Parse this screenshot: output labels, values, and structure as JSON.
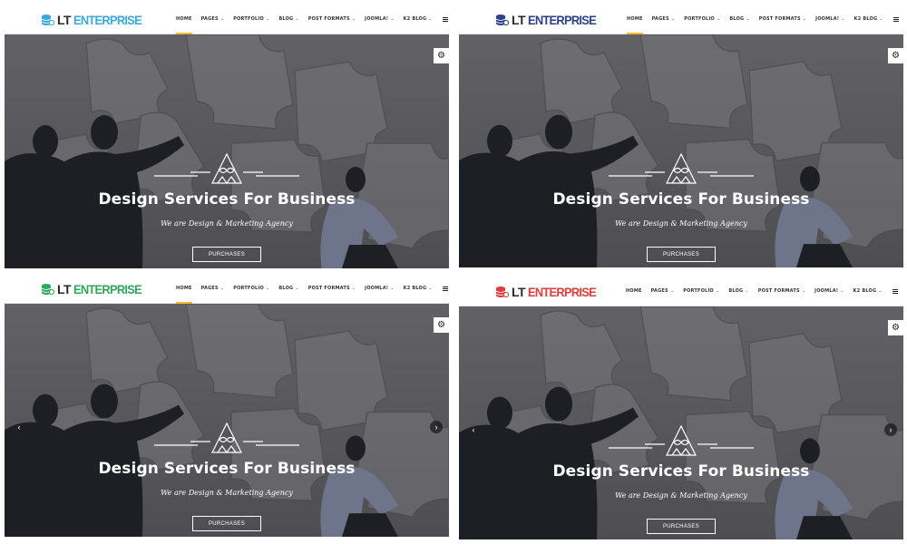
{
  "panels": [
    {
      "logo": {
        "lt": "LT",
        "enterprise": "ENTERPRISE",
        "accent_color": "#39a9dc"
      },
      "nav": [
        {
          "label": "HOME",
          "chevron": false,
          "active": true
        },
        {
          "label": "PAGES",
          "chevron": true
        },
        {
          "label": "PORTFOLIO",
          "chevron": true
        },
        {
          "label": "BLOG",
          "chevron": true
        },
        {
          "label": "POST FORMATS",
          "chevron": true
        },
        {
          "label": "JOOMLA!",
          "chevron": true
        },
        {
          "label": "K2 BLOG",
          "chevron": true
        }
      ],
      "hero": {
        "title": "Design Services For Business",
        "subtitle": "We are Design & Marketing Agency",
        "button": "PURCHASES"
      },
      "show_arrows": false
    },
    {
      "logo": {
        "lt": "LT",
        "enterprise": "ENTERPRISE",
        "accent_color": "#2c3f8c"
      },
      "nav": [
        {
          "label": "HOME",
          "chevron": false,
          "active": true
        },
        {
          "label": "PAGES",
          "chevron": true
        },
        {
          "label": "PORTFOLIO",
          "chevron": true
        },
        {
          "label": "BLOG",
          "chevron": true
        },
        {
          "label": "POST FORMATS",
          "chevron": true
        },
        {
          "label": "JOOMLA!",
          "chevron": true
        },
        {
          "label": "K2 BLOG",
          "chevron": true
        }
      ],
      "hero": {
        "title": "Design Services For Business",
        "subtitle": "We are Design & Marketing Agency",
        "button": "PURCHASES"
      },
      "show_arrows": false
    },
    {
      "logo": {
        "lt": "LT",
        "enterprise": "ENTERPRISE",
        "accent_color": "#2fa85c"
      },
      "nav": [
        {
          "label": "HOME",
          "chevron": false,
          "active": true
        },
        {
          "label": "PAGES",
          "chevron": true
        },
        {
          "label": "PORTFOLIO",
          "chevron": true
        },
        {
          "label": "BLOG",
          "chevron": true
        },
        {
          "label": "POST FORMATS",
          "chevron": true
        },
        {
          "label": "JOOMLA!",
          "chevron": true
        },
        {
          "label": "K2 BLOG",
          "chevron": true
        }
      ],
      "hero": {
        "title": "Design Services For Business",
        "subtitle": "We are Design & Marketing Agency",
        "button": "PURCHASES"
      },
      "show_arrows": true,
      "arrow_icons": {
        "prev": "‹",
        "next": "›"
      }
    },
    {
      "logo": {
        "lt": "LT",
        "enterprise": "ENTERPRISE",
        "accent_color": "#e23b3b"
      },
      "nav": [
        {
          "label": "HOME",
          "chevron": false,
          "active": false
        },
        {
          "label": "PAGES",
          "chevron": true
        },
        {
          "label": "PORTFOLIO",
          "chevron": true
        },
        {
          "label": "BLOG",
          "chevron": true
        },
        {
          "label": "POST FORMATS",
          "chevron": true
        },
        {
          "label": "JOOMLA!",
          "chevron": true
        },
        {
          "label": "K2 BLOG",
          "chevron": true
        }
      ],
      "hero": {
        "title": "Design Services For Business",
        "subtitle": "We are Design & Marketing Agency",
        "button": "PURCHASES"
      },
      "show_arrows": true,
      "arrow_icons": {
        "prev": "‹",
        "next": "›"
      }
    }
  ],
  "icons": {
    "gear": "⚙",
    "chevron": "⌄"
  },
  "colors": {
    "nav_active_underline": "#f7b733"
  }
}
